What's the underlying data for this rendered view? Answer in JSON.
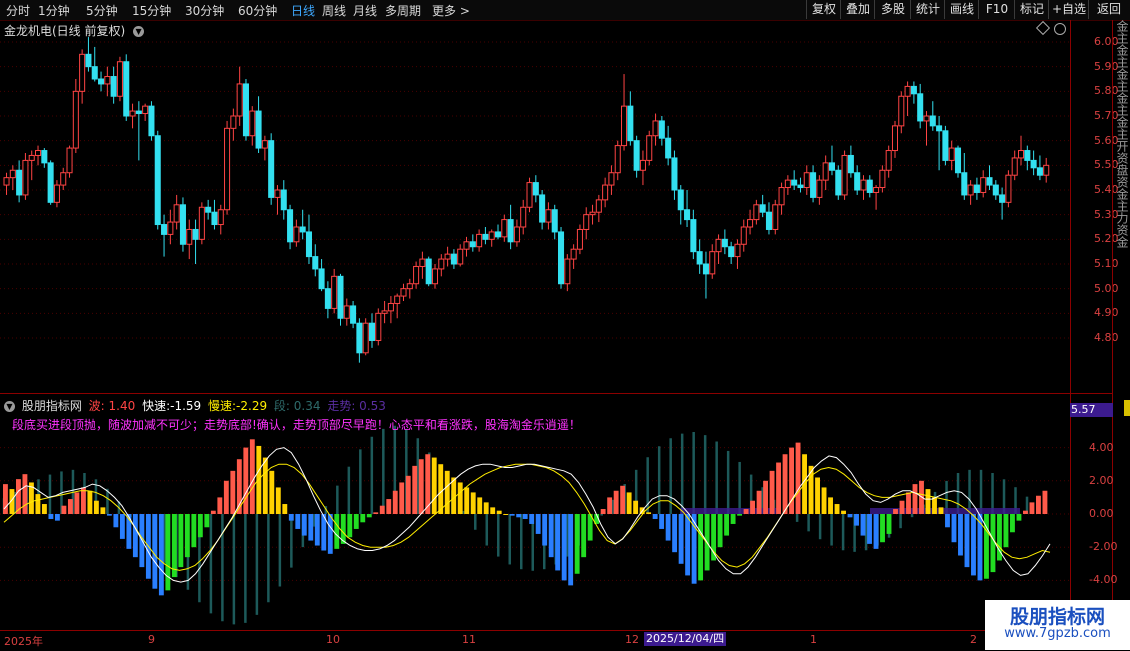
{
  "toolbar": {
    "periods": [
      "分时",
      "1分钟",
      "5分钟",
      "15分钟",
      "30分钟",
      "60分钟",
      "日线",
      "周线",
      "月线",
      "多周期",
      "更多 >"
    ],
    "active_period": "日线",
    "buttons": [
      "复权",
      "叠加",
      "多股",
      "统计",
      "画线",
      "F10",
      "标记",
      "+自选",
      "返回"
    ]
  },
  "symbol_title": "金龙机电(日线 前复权)",
  "price_axis": [
    "6.00",
    "5.90",
    "5.80",
    "5.70",
    "5.60",
    "5.50",
    "5.40",
    "5.30",
    "5.20",
    "5.10",
    "5.00",
    "4.90",
    "4.80"
  ],
  "indicator": {
    "name": "股朋指标网",
    "wave_label": "波: 1.40",
    "fast_label": "快速:-1.59",
    "slow_label": "慢速:-2.29",
    "seg_label": "段: 0.34",
    "trend_label": "走势: 0.53",
    "scroll_text": "段底买进段顶抛，随波加减不可少；走势底部!确认，走势顶部尽早跑！心态平和看涨跌，股海淘金乐逍遥！",
    "axis": [
      "4.00",
      "2.00",
      "0.00",
      "-2.00",
      "-4.00"
    ],
    "price_tag": "5.57"
  },
  "side_strip_text": "金主金主金主金主金主开资盘资金主力资金",
  "date_axis": {
    "labels": [
      "2025年",
      "9",
      "10",
      "11",
      "12",
      "1",
      "2"
    ],
    "cursor_date": "2025/12/04/四"
  },
  "watermark": {
    "line1": "股朋指标网",
    "line2": "www.7gpzb.com"
  },
  "colors": {
    "up": "#ff4444",
    "down": "#33e0f0",
    "accent": "#3fa9ff",
    "tag": "#3c1b8f"
  },
  "candles": [
    [
      5.42,
      5.47,
      5.38,
      5.45
    ],
    [
      5.45,
      5.5,
      5.4,
      5.48
    ],
    [
      5.48,
      5.52,
      5.35,
      5.38
    ],
    [
      5.38,
      5.55,
      5.36,
      5.52
    ],
    [
      5.52,
      5.56,
      5.44,
      5.54
    ],
    [
      5.54,
      5.58,
      5.5,
      5.56
    ],
    [
      5.56,
      5.57,
      5.49,
      5.51
    ],
    [
      5.51,
      5.52,
      5.34,
      5.35
    ],
    [
      5.35,
      5.44,
      5.33,
      5.42
    ],
    [
      5.42,
      5.49,
      5.4,
      5.47
    ],
    [
      5.47,
      5.58,
      5.45,
      5.57
    ],
    [
      5.57,
      5.85,
      5.55,
      5.8
    ],
    [
      5.8,
      5.97,
      5.75,
      5.95
    ],
    [
      5.95,
      6.02,
      5.88,
      5.9
    ],
    [
      5.9,
      5.98,
      5.84,
      5.85
    ],
    [
      5.85,
      5.88,
      5.8,
      5.83
    ],
    [
      5.83,
      5.9,
      5.78,
      5.86
    ],
    [
      5.86,
      5.9,
      5.75,
      5.78
    ],
    [
      5.78,
      5.94,
      5.76,
      5.92
    ],
    [
      5.92,
      5.95,
      5.68,
      5.7
    ],
    [
      5.7,
      5.75,
      5.65,
      5.72
    ],
    [
      5.72,
      5.76,
      5.52,
      5.71
    ],
    [
      5.71,
      5.75,
      5.68,
      5.74
    ],
    [
      5.74,
      5.76,
      5.6,
      5.62
    ],
    [
      5.62,
      5.64,
      5.24,
      5.26
    ],
    [
      5.26,
      5.3,
      5.13,
      5.22
    ],
    [
      5.22,
      5.32,
      5.18,
      5.27
    ],
    [
      5.27,
      5.38,
      5.24,
      5.34
    ],
    [
      5.34,
      5.37,
      5.15,
      5.18
    ],
    [
      5.18,
      5.28,
      5.12,
      5.24
    ],
    [
      5.24,
      5.28,
      5.1,
      5.2
    ],
    [
      5.2,
      5.35,
      5.18,
      5.33
    ],
    [
      5.33,
      5.36,
      5.28,
      5.31
    ],
    [
      5.31,
      5.36,
      5.24,
      5.26
    ],
    [
      5.26,
      5.34,
      5.22,
      5.32
    ],
    [
      5.32,
      5.68,
      5.3,
      5.65
    ],
    [
      5.65,
      5.73,
      5.6,
      5.7
    ],
    [
      5.7,
      5.9,
      5.66,
      5.83
    ],
    [
      5.83,
      5.85,
      5.6,
      5.62
    ],
    [
      5.62,
      5.74,
      5.58,
      5.72
    ],
    [
      5.72,
      5.78,
      5.55,
      5.57
    ],
    [
      5.57,
      5.62,
      5.52,
      5.6
    ],
    [
      5.6,
      5.63,
      5.34,
      5.37
    ],
    [
      5.37,
      5.42,
      5.3,
      5.4
    ],
    [
      5.4,
      5.44,
      5.28,
      5.32
    ],
    [
      5.32,
      5.34,
      5.16,
      5.19
    ],
    [
      5.19,
      5.28,
      5.17,
      5.25
    ],
    [
      5.25,
      5.32,
      5.2,
      5.23
    ],
    [
      5.23,
      5.3,
      5.1,
      5.13
    ],
    [
      5.13,
      5.18,
      5.05,
      5.08
    ],
    [
      5.08,
      5.12,
      4.99,
      5.0
    ],
    [
      5.0,
      5.03,
      4.88,
      4.92
    ],
    [
      4.92,
      5.08,
      4.9,
      5.05
    ],
    [
      5.05,
      5.06,
      4.85,
      4.88
    ],
    [
      4.88,
      4.96,
      4.85,
      4.93
    ],
    [
      4.93,
      4.95,
      4.84,
      4.86
    ],
    [
      4.86,
      4.88,
      4.7,
      4.74
    ],
    [
      4.74,
      4.88,
      4.73,
      4.86
    ],
    [
      4.86,
      4.9,
      4.76,
      4.79
    ],
    [
      4.79,
      4.92,
      4.77,
      4.9
    ],
    [
      4.9,
      4.95,
      4.86,
      4.91
    ],
    [
      4.91,
      4.97,
      4.86,
      4.94
    ],
    [
      4.94,
      4.98,
      4.88,
      4.97
    ],
    [
      4.97,
      5.02,
      4.95,
      5.0
    ],
    [
      5.0,
      5.04,
      4.96,
      5.02
    ],
    [
      5.02,
      5.11,
      5.0,
      5.09
    ],
    [
      5.09,
      5.15,
      5.04,
      5.12
    ],
    [
      5.12,
      5.13,
      5.01,
      5.02
    ],
    [
      5.02,
      5.1,
      5.0,
      5.08
    ],
    [
      5.08,
      5.14,
      5.05,
      5.12
    ],
    [
      5.12,
      5.17,
      5.09,
      5.14
    ],
    [
      5.14,
      5.16,
      5.08,
      5.1
    ],
    [
      5.1,
      5.18,
      5.09,
      5.16
    ],
    [
      5.16,
      5.21,
      5.13,
      5.19
    ],
    [
      5.19,
      5.22,
      5.15,
      5.17
    ],
    [
      5.17,
      5.24,
      5.15,
      5.22
    ],
    [
      5.22,
      5.25,
      5.18,
      5.2
    ],
    [
      5.2,
      5.24,
      5.17,
      5.23
    ],
    [
      5.23,
      5.26,
      5.2,
      5.21
    ],
    [
      5.21,
      5.3,
      5.19,
      5.28
    ],
    [
      5.28,
      5.34,
      5.16,
      5.19
    ],
    [
      5.19,
      5.28,
      5.17,
      5.25
    ],
    [
      5.25,
      5.36,
      5.22,
      5.33
    ],
    [
      5.33,
      5.45,
      5.31,
      5.43
    ],
    [
      5.43,
      5.46,
      5.35,
      5.38
    ],
    [
      5.38,
      5.4,
      5.24,
      5.27
    ],
    [
      5.27,
      5.35,
      5.24,
      5.32
    ],
    [
      5.32,
      5.34,
      5.2,
      5.23
    ],
    [
      5.23,
      5.25,
      5.0,
      5.02
    ],
    [
      5.02,
      5.14,
      4.99,
      5.12
    ],
    [
      5.12,
      5.18,
      5.08,
      5.16
    ],
    [
      5.16,
      5.26,
      5.14,
      5.24
    ],
    [
      5.24,
      5.33,
      5.2,
      5.3
    ],
    [
      5.3,
      5.34,
      5.26,
      5.31
    ],
    [
      5.31,
      5.38,
      5.27,
      5.36
    ],
    [
      5.36,
      5.45,
      5.33,
      5.42
    ],
    [
      5.42,
      5.5,
      5.38,
      5.47
    ],
    [
      5.47,
      5.6,
      5.44,
      5.58
    ],
    [
      5.58,
      5.87,
      5.56,
      5.74
    ],
    [
      5.74,
      5.8,
      5.58,
      5.6
    ],
    [
      5.6,
      5.62,
      5.45,
      5.48
    ],
    [
      5.48,
      5.56,
      5.42,
      5.52
    ],
    [
      5.52,
      5.64,
      5.5,
      5.62
    ],
    [
      5.62,
      5.71,
      5.58,
      5.68
    ],
    [
      5.68,
      5.7,
      5.58,
      5.61
    ],
    [
      5.61,
      5.66,
      5.5,
      5.53
    ],
    [
      5.53,
      5.56,
      5.36,
      5.4
    ],
    [
      5.4,
      5.42,
      5.26,
      5.32
    ],
    [
      5.32,
      5.4,
      5.25,
      5.28
    ],
    [
      5.28,
      5.32,
      5.12,
      5.15
    ],
    [
      5.15,
      5.2,
      5.06,
      5.1
    ],
    [
      5.1,
      5.15,
      4.96,
      5.06
    ],
    [
      5.06,
      5.18,
      5.04,
      5.15
    ],
    [
      5.15,
      5.22,
      5.1,
      5.2
    ],
    [
      5.2,
      5.24,
      5.14,
      5.17
    ],
    [
      5.17,
      5.19,
      5.1,
      5.13
    ],
    [
      5.13,
      5.2,
      5.08,
      5.18
    ],
    [
      5.18,
      5.28,
      5.15,
      5.25
    ],
    [
      5.25,
      5.32,
      5.22,
      5.28
    ],
    [
      5.28,
      5.36,
      5.26,
      5.34
    ],
    [
      5.34,
      5.38,
      5.29,
      5.31
    ],
    [
      5.31,
      5.35,
      5.22,
      5.24
    ],
    [
      5.24,
      5.36,
      5.22,
      5.34
    ],
    [
      5.34,
      5.43,
      5.3,
      5.41
    ],
    [
      5.41,
      5.46,
      5.38,
      5.44
    ],
    [
      5.44,
      5.48,
      5.4,
      5.42
    ],
    [
      5.42,
      5.45,
      5.39,
      5.41
    ],
    [
      5.41,
      5.5,
      5.38,
      5.47
    ],
    [
      5.47,
      5.5,
      5.35,
      5.37
    ],
    [
      5.37,
      5.46,
      5.34,
      5.44
    ],
    [
      5.44,
      5.54,
      5.4,
      5.51
    ],
    [
      5.51,
      5.58,
      5.46,
      5.48
    ],
    [
      5.48,
      5.5,
      5.36,
      5.38
    ],
    [
      5.38,
      5.56,
      5.36,
      5.54
    ],
    [
      5.54,
      5.58,
      5.45,
      5.47
    ],
    [
      5.47,
      5.5,
      5.38,
      5.4
    ],
    [
      5.4,
      5.46,
      5.36,
      5.44
    ],
    [
      5.44,
      5.46,
      5.37,
      5.39
    ],
    [
      5.39,
      5.42,
      5.32,
      5.41
    ],
    [
      5.41,
      5.5,
      5.39,
      5.48
    ],
    [
      5.48,
      5.58,
      5.45,
      5.56
    ],
    [
      5.56,
      5.68,
      5.53,
      5.66
    ],
    [
      5.66,
      5.8,
      5.63,
      5.78
    ],
    [
      5.78,
      5.84,
      5.7,
      5.82
    ],
    [
      5.82,
      5.84,
      5.75,
      5.79
    ],
    [
      5.79,
      5.83,
      5.65,
      5.68
    ],
    [
      5.68,
      5.72,
      5.58,
      5.7
    ],
    [
      5.7,
      5.76,
      5.64,
      5.66
    ],
    [
      5.66,
      5.7,
      5.48,
      5.64
    ],
    [
      5.64,
      5.66,
      5.5,
      5.52
    ],
    [
      5.52,
      5.6,
      5.48,
      5.57
    ],
    [
      5.57,
      5.58,
      5.45,
      5.47
    ],
    [
      5.47,
      5.55,
      5.36,
      5.38
    ],
    [
      5.38,
      5.44,
      5.34,
      5.42
    ],
    [
      5.42,
      5.45,
      5.36,
      5.39
    ],
    [
      5.39,
      5.48,
      5.37,
      5.45
    ],
    [
      5.45,
      5.5,
      5.4,
      5.42
    ],
    [
      5.42,
      5.44,
      5.36,
      5.38
    ],
    [
      5.38,
      5.41,
      5.28,
      5.35
    ],
    [
      5.35,
      5.48,
      5.33,
      5.46
    ],
    [
      5.46,
      5.56,
      5.44,
      5.53
    ],
    [
      5.53,
      5.62,
      5.5,
      5.56
    ],
    [
      5.56,
      5.58,
      5.48,
      5.52
    ],
    [
      5.52,
      5.56,
      5.46,
      5.49
    ],
    [
      5.49,
      5.54,
      5.44,
      5.46
    ],
    [
      5.46,
      5.53,
      5.43,
      5.5
    ]
  ],
  "indicator_bars": [
    1.8,
    1.5,
    2.1,
    2.4,
    1.9,
    1.2,
    0.6,
    -0.3,
    -0.4,
    0.5,
    0.9,
    1.3,
    1.6,
    1.4,
    0.8,
    0.4,
    -0.1,
    -0.8,
    -1.5,
    -2.1,
    -2.6,
    -3.2,
    -3.9,
    -4.5,
    -4.9,
    -4.6,
    -3.8,
    -3.2,
    -2.6,
    -2.0,
    -1.4,
    -0.8,
    0.2,
    1.0,
    2.0,
    2.6,
    3.3,
    4.0,
    4.5,
    4.1,
    3.4,
    2.6,
    1.6,
    0.6,
    -0.4,
    -0.9,
    -1.3,
    -1.6,
    -1.9,
    -2.2,
    -2.4,
    -2.1,
    -1.8,
    -1.4,
    -0.9,
    -0.5,
    -0.2,
    0.1,
    0.5,
    0.9,
    1.4,
    1.9,
    2.3,
    2.9,
    3.3,
    3.6,
    3.4,
    3.0,
    2.6,
    2.2,
    1.9,
    1.6,
    1.3,
    1.0,
    0.7,
    0.4,
    0.2,
    0.0,
    -0.1,
    -0.2,
    -0.3,
    -0.6,
    -1.2,
    -1.9,
    -2.6,
    -3.4,
    -4.0,
    -4.3,
    -3.6,
    -2.6,
    -1.6,
    -0.6,
    0.3,
    1.0,
    1.4,
    1.7,
    1.3,
    0.8,
    0.4,
    0.1,
    -0.3,
    -0.9,
    -1.6,
    -2.3,
    -3.0,
    -3.7,
    -4.2,
    -4.0,
    -3.4,
    -2.8,
    -2.0,
    -1.3,
    -0.6,
    -0.1,
    0.3,
    0.8,
    1.4,
    2.0,
    2.6,
    3.1,
    3.6,
    4.0,
    4.3,
    3.6,
    2.9,
    2.2,
    1.6,
    1.0,
    0.6,
    0.2,
    -0.2,
    -0.7,
    -1.3,
    -1.8,
    -2.1,
    -1.7,
    -1.2,
    0.3,
    0.8,
    1.3,
    1.8,
    2.0,
    1.5,
    1.0,
    0.4,
    -0.8,
    -1.7,
    -2.5,
    -3.2,
    -3.7,
    -4.0,
    -3.9,
    -3.5,
    -2.8,
    -2.0,
    -1.1,
    -0.4,
    0.2,
    0.7,
    1.1,
    1.4
  ],
  "fast_line": [
    0.3,
    0.8,
    1.4,
    1.7,
    1.6,
    1.3,
    1.0,
    1.1,
    1.3,
    1.4,
    1.5,
    1.6,
    1.8,
    1.7,
    1.4,
    1.0,
    0.5,
    -0.2,
    -1.0,
    -1.8,
    -2.6,
    -3.2,
    -3.7,
    -4.0,
    -4.1,
    -4.0,
    -3.6,
    -3.0,
    -2.3,
    -1.6,
    -0.9,
    -0.2,
    0.6,
    1.4,
    2.2,
    2.9,
    3.5,
    3.9,
    4.0,
    3.7,
    3.0,
    2.1,
    1.1,
    0.2,
    -0.6,
    -1.2,
    -1.6,
    -1.9,
    -2.1,
    -2.2,
    -2.2,
    -2.1,
    -1.9,
    -1.6,
    -1.2,
    -0.8,
    -0.3,
    0.2,
    0.7,
    1.2,
    1.6,
    2.0,
    2.4,
    2.7,
    2.9,
    3.0,
    3.0,
    2.9,
    2.8,
    2.8,
    2.9,
    3.0,
    3.0,
    2.9,
    2.8,
    2.7,
    2.6,
    2.4,
    1.9,
    1.2,
    0.4,
    -0.6,
    -1.4,
    -1.8,
    -1.5,
    -0.9,
    -0.2,
    0.4,
    0.9,
    1.1,
    1.1,
    0.9,
    0.5,
    0.0,
    -0.7,
    -1.4,
    -2.1,
    -2.8,
    -3.3,
    -3.6,
    -3.6,
    -3.2,
    -2.6,
    -1.9,
    -1.2,
    -0.5,
    0.2,
    0.9,
    1.6,
    2.2,
    2.8,
    3.2,
    3.5,
    3.4,
    3.0,
    2.5,
    1.8,
    1.2,
    0.8,
    0.7,
    0.9,
    1.2,
    1.4,
    1.4,
    1.2,
    0.9,
    0.9,
    1.1,
    1.3,
    1.4,
    1.3,
    0.9,
    0.3,
    -0.5,
    -1.3,
    -2.1,
    -2.8,
    -3.4,
    -3.7,
    -3.6,
    -3.1,
    -2.5,
    -1.8
  ],
  "slow_line": [
    -0.5,
    -0.1,
    0.3,
    0.6,
    0.8,
    0.9,
    1.0,
    1.1,
    1.2,
    1.3,
    1.4,
    1.4,
    1.3,
    1.1,
    0.8,
    0.4,
    -0.1,
    -0.7,
    -1.4,
    -2.0,
    -2.6,
    -3.0,
    -3.3,
    -3.4,
    -3.3,
    -3.1,
    -2.7,
    -2.2,
    -1.6,
    -0.9,
    -0.2,
    0.5,
    1.2,
    1.9,
    2.4,
    2.8,
    3.0,
    3.0,
    2.8,
    2.4,
    1.8,
    1.1,
    0.4,
    -0.3,
    -0.9,
    -1.4,
    -1.7,
    -1.9,
    -2.0,
    -2.0,
    -2.0,
    -1.9,
    -1.7,
    -1.4,
    -1.0,
    -0.6,
    -0.2,
    0.2,
    0.6,
    1.0,
    1.4,
    1.8,
    2.1,
    2.4,
    2.6,
    2.8,
    2.9,
    3.0,
    3.0,
    3.0,
    2.9,
    2.8,
    2.6,
    2.3,
    1.9,
    1.3,
    0.6,
    -0.2,
    -1.0,
    -1.6,
    -1.8,
    -1.5,
    -1.0,
    -0.4,
    0.2,
    0.6,
    0.8,
    0.8,
    0.5,
    0.1,
    -0.5,
    -1.1,
    -1.7,
    -2.3,
    -2.8,
    -3.1,
    -3.2,
    -3.0,
    -2.6,
    -2.0,
    -1.4,
    -0.7,
    0.0,
    0.7,
    1.3,
    1.9,
    2.4,
    2.7,
    2.8,
    2.7,
    2.4,
    2.0,
    1.6,
    1.3,
    1.1,
    1.0,
    1.0,
    1.1,
    1.2,
    1.3,
    1.2,
    1.1,
    1.0,
    0.9,
    0.8,
    0.6,
    0.3,
    -0.1,
    -0.6,
    -1.2,
    -1.8,
    -2.3,
    -2.6,
    -2.7,
    -2.6,
    -2.4,
    -2.2,
    -2.3
  ],
  "trend_wave": [
    1.0,
    1.4,
    1.8,
    2.2,
    2.5,
    2.7,
    2.8,
    2.6,
    2.2,
    1.6,
    0.8,
    -0.2,
    -1.2,
    -2.2,
    -3.1,
    -4.0,
    -4.8,
    -5.6,
    -6.3,
    -6.8,
    -7.0,
    -6.9,
    -6.4,
    -5.6,
    -4.6,
    -3.4,
    -2.1,
    -0.8,
    0.5,
    1.8,
    3.0,
    4.1,
    4.9,
    5.4,
    5.6,
    5.4,
    4.8,
    3.9,
    2.8,
    1.5,
    0.2,
    -1.0,
    -2.0,
    -2.7,
    -3.2,
    -3.5,
    -3.6,
    -3.5,
    -3.2,
    -2.7,
    -2.0,
    -1.1,
    -0.1,
    0.9,
    1.9,
    2.8,
    3.6,
    4.3,
    4.8,
    5.1,
    5.2,
    5.0,
    4.6,
    4.0,
    3.3,
    2.5,
    1.7,
    0.9,
    0.2,
    -0.5,
    -1.1,
    -1.6,
    -2.0,
    -2.3,
    -2.4,
    -2.3,
    -2.0,
    -1.5,
    -0.9,
    -0.2,
    0.6,
    1.4,
    2.1,
    2.6,
    2.8,
    2.8,
    2.6,
    2.2,
    1.7,
    1.1,
    0.5
  ]
}
